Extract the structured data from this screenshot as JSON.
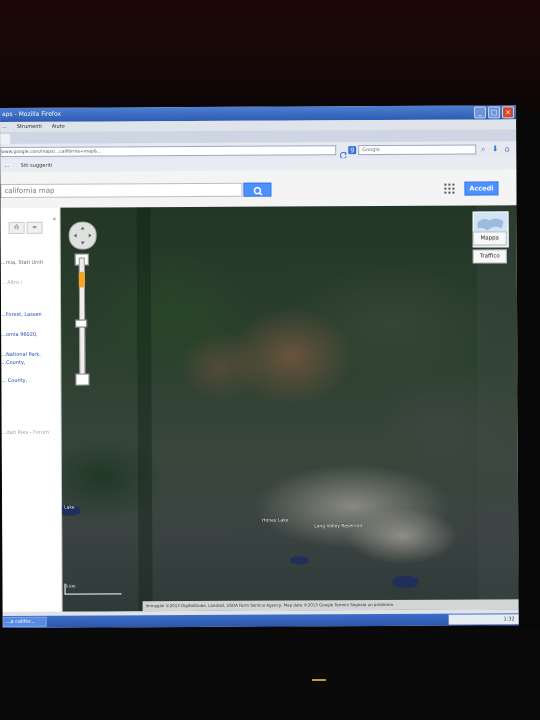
{
  "window": {
    "title": "aps - Mozilla Firefox",
    "controls": [
      "_",
      "□",
      "×"
    ]
  },
  "menu": {
    "items": [
      "...",
      "Strumenti",
      "Aiuto"
    ]
  },
  "navbar": {
    "url": "www.google.com/maps/...california+map&...",
    "search_placeholder": "Google"
  },
  "bookmarks": {
    "items": [
      "...",
      "Siti suggeriti"
    ]
  },
  "google_bar": {
    "search_value": "california map",
    "signin_label": "Accedi"
  },
  "sidepanel": {
    "lines": [
      "...rnia, Stati Uniti",
      "...   Altro ›",
      "...Forest, Lassen",
      "...ornia 96020,",
      "...National Park,",
      "...County,",
      "... County,",
      "...dati Ries - Forum"
    ]
  },
  "map": {
    "layer_buttons": [
      "Mappa",
      "Traffico"
    ],
    "place_labels": [
      "Lake",
      "Honey Lake",
      "Long Valley Reservoir"
    ],
    "scale_label": "5 km",
    "attribution": "Immagini ©2013 DigitalGlobe, Landsat, USDA Farm Service Agency, Map data ©2013 Google    Termini   Segnala un problema"
  },
  "taskbar": {
    "task_label": "...a califor...",
    "clock": "1:32"
  },
  "icons": [
    "search-icon",
    "apps-grid-icon",
    "print-icon",
    "link-icon",
    "close-icon",
    "pan-control-icon",
    "pegman-icon",
    "reload-icon",
    "google-icon",
    "download-icon",
    "home-icon",
    "zoom-in-icon",
    "zoom-out-icon"
  ]
}
